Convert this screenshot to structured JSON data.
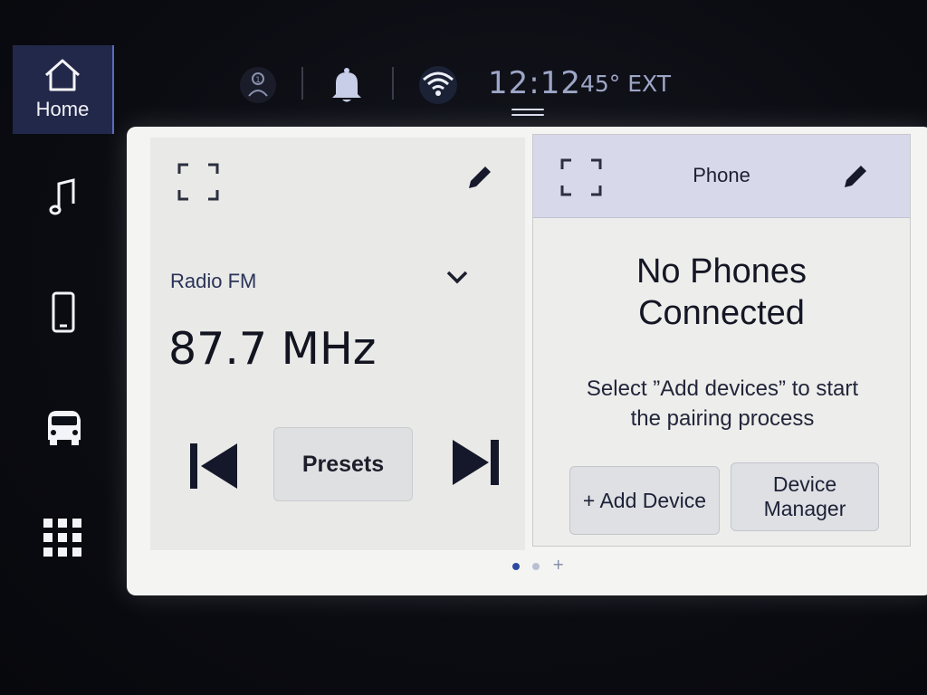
{
  "sidebar": {
    "items": [
      {
        "label": "Home",
        "icon": "home-icon",
        "active": true
      },
      {
        "label": "",
        "icon": "music-note-icon"
      },
      {
        "label": "",
        "icon": "phone-icon"
      },
      {
        "label": "",
        "icon": "vehicle-icon"
      },
      {
        "label": "",
        "icon": "app-grid-icon"
      }
    ]
  },
  "status": {
    "time": "12:12",
    "temperature": "45° EXT",
    "icons": [
      "driver-profile-icon",
      "notification-bell-icon",
      "wifi-hotspot-icon"
    ]
  },
  "radio": {
    "source": "Radio FM",
    "frequency": "87.7 MHz",
    "presets_label": "Presets"
  },
  "phone": {
    "title": "Phone",
    "message_line1": "No Phones",
    "message_line2": "Connected",
    "hint_line1": "Select ”Add devices” to start",
    "hint_line2": "the pairing process",
    "add_device_label": "+ Add Device",
    "device_manager_line1": "Device",
    "device_manager_line2": "Manager"
  },
  "pager": {
    "plus": "+"
  },
  "colors": {
    "accent": "#2a3358",
    "active_sidebar": "#22284a",
    "phone_header": "#d7d9ea",
    "clock": "#9da6c6"
  }
}
